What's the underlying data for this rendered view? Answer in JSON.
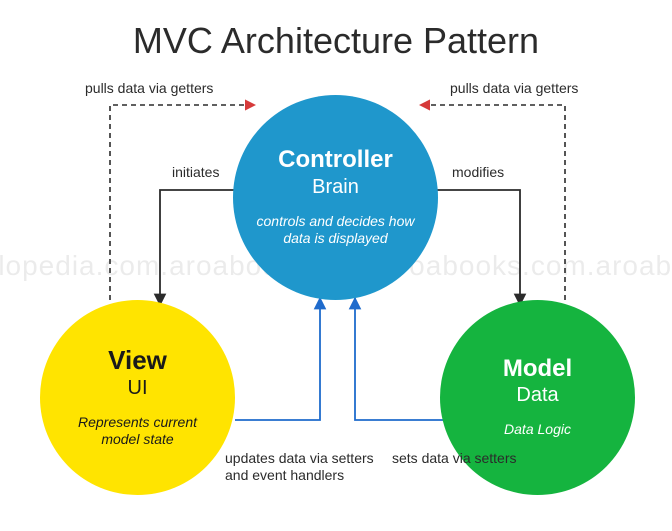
{
  "title": "MVC Architecture Pattern",
  "watermark": "ncyclopedia.com.aroabooks.com.aroabooks.com.aroabooks",
  "controller": {
    "name": "Controller",
    "role": "Brain",
    "desc": "controls and decides how data is displayed"
  },
  "view": {
    "name": "View",
    "role": "UI",
    "desc": "Represents current model state"
  },
  "model": {
    "name": "Model",
    "role": "Data",
    "desc": "Data Logic"
  },
  "edges": {
    "view_to_controller_dashed": "pulls data via getters",
    "controller_to_view": "initiates",
    "view_to_controller_solid": "updates data via setters and event handlers",
    "controller_to_model": "modifies",
    "model_to_controller_dashed": "pulls data via getters",
    "model_to_controller_solid": "sets data via setters"
  }
}
